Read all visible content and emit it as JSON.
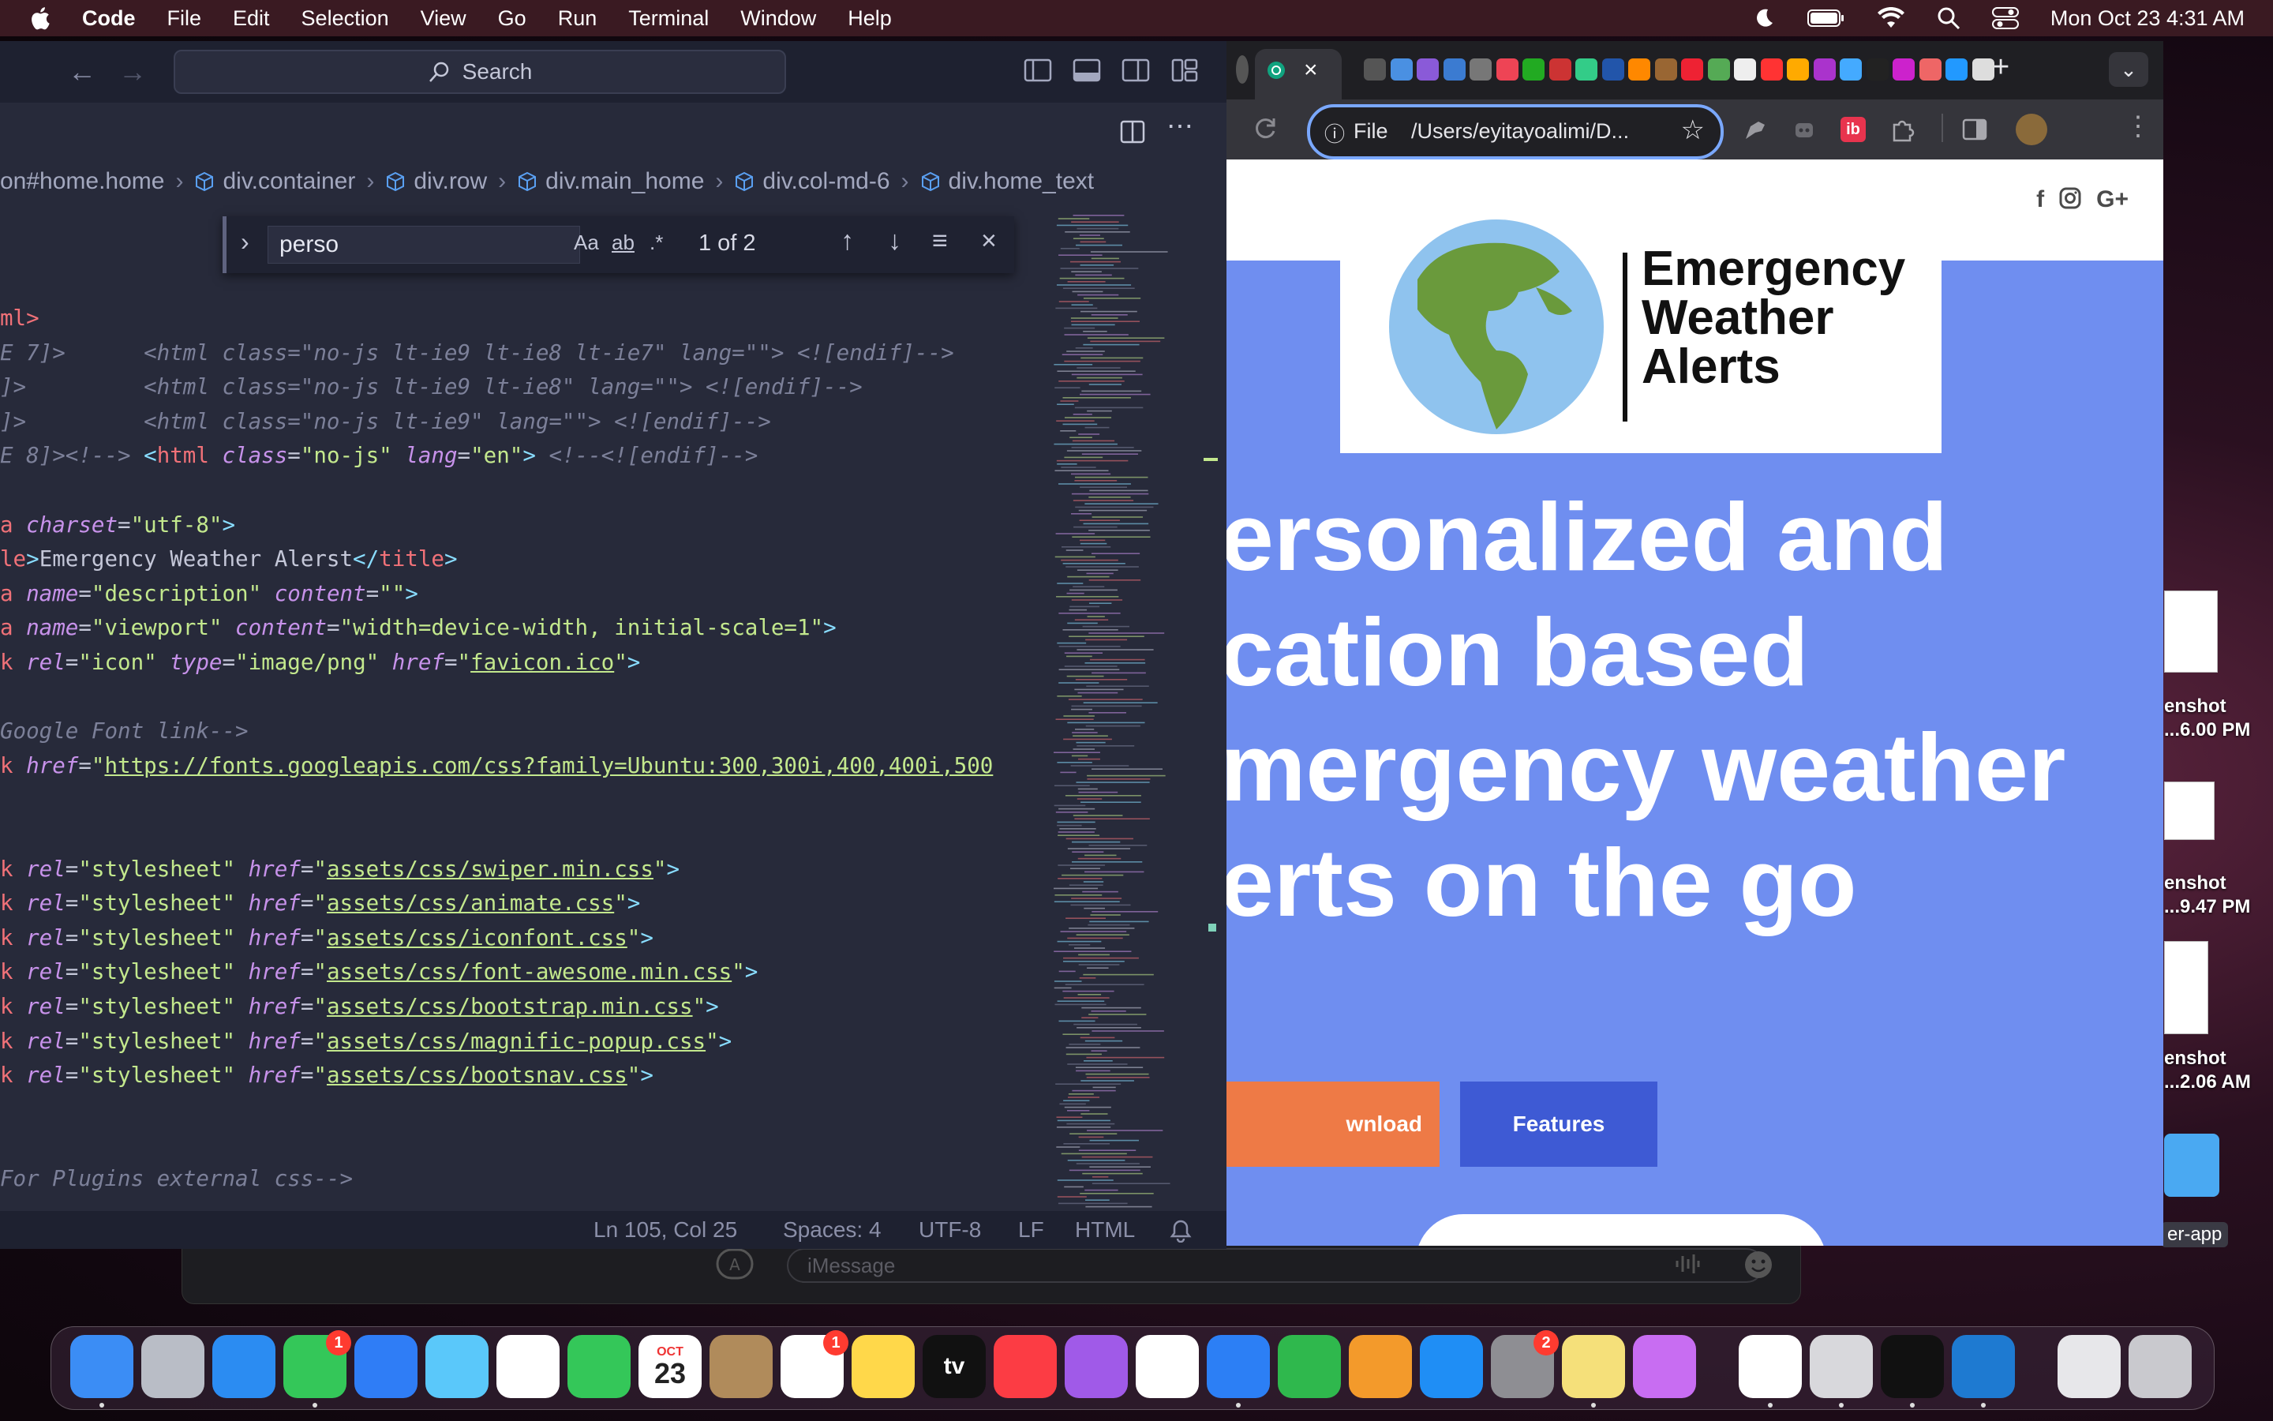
{
  "menubar": {
    "app_name": "Code",
    "items": [
      "File",
      "Edit",
      "Selection",
      "View",
      "Go",
      "Run",
      "Terminal",
      "Window",
      "Help"
    ],
    "clock": "Mon Oct 23  4:31 AM"
  },
  "vscode": {
    "search_label": "Search",
    "breadcrumb": [
      "on#home.home",
      "div.container",
      "div.row",
      "div.main_home",
      "div.col-md-6",
      "div.home_text"
    ],
    "find": {
      "query": "perso",
      "match_case": "Aa",
      "whole_word": "ab",
      "regex": ".*",
      "count": "1 of 2"
    },
    "code_lines": [
      {
        "segments": [
          {
            "t": "ml>",
            "c": "tg"
          }
        ]
      },
      {
        "segments": [
          {
            "t": "E 7]>      ",
            "c": "cm"
          },
          {
            "t": "<html class=\"no-js lt-ie9 lt-ie8 lt-ie7\" lang=\"\"> <![endif]-->",
            "c": "cm"
          }
        ]
      },
      {
        "segments": [
          {
            "t": "]>         ",
            "c": "cm"
          },
          {
            "t": "<html class=\"no-js lt-ie9 lt-ie8\" lang=\"\"> <![endif]-->",
            "c": "cm"
          }
        ]
      },
      {
        "segments": [
          {
            "t": "]>         ",
            "c": "cm"
          },
          {
            "t": "<html class=\"no-js lt-ie9\" lang=\"\"> <![endif]-->",
            "c": "cm"
          }
        ]
      },
      {
        "segments": [
          {
            "t": "E 8]><!--> ",
            "c": "cm"
          },
          {
            "t": "<",
            "c": "tgp"
          },
          {
            "t": "html",
            "c": "tg"
          },
          {
            "t": " class",
            "c": "at"
          },
          {
            "t": "=",
            "c": ""
          },
          {
            "t": "\"no-js\"",
            "c": "st"
          },
          {
            "t": " lang",
            "c": "at"
          },
          {
            "t": "=",
            "c": ""
          },
          {
            "t": "\"en\"",
            "c": "st"
          },
          {
            "t": ">",
            "c": "tgp"
          },
          {
            "t": " <!--<![endif]-->",
            "c": "cm"
          }
        ]
      },
      {
        "segments": []
      },
      {
        "segments": [
          {
            "t": "a",
            "c": "tg"
          },
          {
            "t": " charset",
            "c": "at"
          },
          {
            "t": "=",
            "c": ""
          },
          {
            "t": "\"utf-8\"",
            "c": "st"
          },
          {
            "t": ">",
            "c": "tgp"
          }
        ]
      },
      {
        "segments": [
          {
            "t": "le",
            "c": "tg"
          },
          {
            "t": ">",
            "c": "tgp"
          },
          {
            "t": "Emergency Weather Alerst",
            "c": ""
          },
          {
            "t": "</",
            "c": "tgp"
          },
          {
            "t": "title",
            "c": "tg"
          },
          {
            "t": ">",
            "c": "tgp"
          }
        ]
      },
      {
        "segments": [
          {
            "t": "a",
            "c": "tg"
          },
          {
            "t": " name",
            "c": "at"
          },
          {
            "t": "=",
            "c": ""
          },
          {
            "t": "\"description\"",
            "c": "st"
          },
          {
            "t": " content",
            "c": "at"
          },
          {
            "t": "=",
            "c": ""
          },
          {
            "t": "\"\"",
            "c": "st"
          },
          {
            "t": ">",
            "c": "tgp"
          }
        ]
      },
      {
        "segments": [
          {
            "t": "a",
            "c": "tg"
          },
          {
            "t": " name",
            "c": "at"
          },
          {
            "t": "=",
            "c": ""
          },
          {
            "t": "\"viewport\"",
            "c": "st"
          },
          {
            "t": " content",
            "c": "at"
          },
          {
            "t": "=",
            "c": ""
          },
          {
            "t": "\"width=device-width, initial-scale=1\"",
            "c": "st"
          },
          {
            "t": ">",
            "c": "tgp"
          }
        ]
      },
      {
        "segments": [
          {
            "t": "k",
            "c": "tg"
          },
          {
            "t": " rel",
            "c": "at"
          },
          {
            "t": "=",
            "c": ""
          },
          {
            "t": "\"icon\"",
            "c": "st"
          },
          {
            "t": " type",
            "c": "at"
          },
          {
            "t": "=",
            "c": ""
          },
          {
            "t": "\"image/png\"",
            "c": "st"
          },
          {
            "t": " href",
            "c": "at"
          },
          {
            "t": "=",
            "c": ""
          },
          {
            "t": "\"",
            "c": "st"
          },
          {
            "t": "favicon.ico",
            "c": "st ul"
          },
          {
            "t": "\"",
            "c": "st"
          },
          {
            "t": ">",
            "c": "tgp"
          }
        ]
      },
      {
        "segments": []
      },
      {
        "segments": [
          {
            "t": "Google Font link-->",
            "c": "cm"
          }
        ]
      },
      {
        "segments": [
          {
            "t": "k",
            "c": "tg"
          },
          {
            "t": " href",
            "c": "at"
          },
          {
            "t": "=",
            "c": ""
          },
          {
            "t": "\"",
            "c": "st"
          },
          {
            "t": "https://fonts.googleapis.com/css?family=Ubuntu:300,300i,400,400i,500",
            "c": "st ul"
          }
        ]
      },
      {
        "segments": []
      },
      {
        "segments": []
      },
      {
        "segments": [
          {
            "t": "k",
            "c": "tg"
          },
          {
            "t": " rel",
            "c": "at"
          },
          {
            "t": "=",
            "c": ""
          },
          {
            "t": "\"stylesheet\"",
            "c": "st"
          },
          {
            "t": " href",
            "c": "at"
          },
          {
            "t": "=",
            "c": ""
          },
          {
            "t": "\"",
            "c": "st"
          },
          {
            "t": "assets/css/swiper.min.css",
            "c": "st ul"
          },
          {
            "t": "\"",
            "c": "st"
          },
          {
            "t": ">",
            "c": "tgp"
          }
        ]
      },
      {
        "segments": [
          {
            "t": "k",
            "c": "tg"
          },
          {
            "t": " rel",
            "c": "at"
          },
          {
            "t": "=",
            "c": ""
          },
          {
            "t": "\"stylesheet\"",
            "c": "st"
          },
          {
            "t": " href",
            "c": "at"
          },
          {
            "t": "=",
            "c": ""
          },
          {
            "t": "\"",
            "c": "st"
          },
          {
            "t": "assets/css/animate.css",
            "c": "st ul"
          },
          {
            "t": "\"",
            "c": "st"
          },
          {
            "t": ">",
            "c": "tgp"
          }
        ]
      },
      {
        "segments": [
          {
            "t": "k",
            "c": "tg"
          },
          {
            "t": " rel",
            "c": "at"
          },
          {
            "t": "=",
            "c": ""
          },
          {
            "t": "\"stylesheet\"",
            "c": "st"
          },
          {
            "t": " href",
            "c": "at"
          },
          {
            "t": "=",
            "c": ""
          },
          {
            "t": "\"",
            "c": "st"
          },
          {
            "t": "assets/css/iconfont.css",
            "c": "st ul"
          },
          {
            "t": "\"",
            "c": "st"
          },
          {
            "t": ">",
            "c": "tgp"
          }
        ]
      },
      {
        "segments": [
          {
            "t": "k",
            "c": "tg"
          },
          {
            "t": " rel",
            "c": "at"
          },
          {
            "t": "=",
            "c": ""
          },
          {
            "t": "\"stylesheet\"",
            "c": "st"
          },
          {
            "t": " href",
            "c": "at"
          },
          {
            "t": "=",
            "c": ""
          },
          {
            "t": "\"",
            "c": "st"
          },
          {
            "t": "assets/css/font-awesome.min.css",
            "c": "st ul"
          },
          {
            "t": "\"",
            "c": "st"
          },
          {
            "t": ">",
            "c": "tgp"
          }
        ]
      },
      {
        "segments": [
          {
            "t": "k",
            "c": "tg"
          },
          {
            "t": " rel",
            "c": "at"
          },
          {
            "t": "=",
            "c": ""
          },
          {
            "t": "\"stylesheet\"",
            "c": "st"
          },
          {
            "t": " href",
            "c": "at"
          },
          {
            "t": "=",
            "c": ""
          },
          {
            "t": "\"",
            "c": "st"
          },
          {
            "t": "assets/css/bootstrap.min.css",
            "c": "st ul"
          },
          {
            "t": "\"",
            "c": "st"
          },
          {
            "t": ">",
            "c": "tgp"
          }
        ]
      },
      {
        "segments": [
          {
            "t": "k",
            "c": "tg"
          },
          {
            "t": " rel",
            "c": "at"
          },
          {
            "t": "=",
            "c": ""
          },
          {
            "t": "\"stylesheet\"",
            "c": "st"
          },
          {
            "t": " href",
            "c": "at"
          },
          {
            "t": "=",
            "c": ""
          },
          {
            "t": "\"",
            "c": "st"
          },
          {
            "t": "assets/css/magnific-popup.css",
            "c": "st ul"
          },
          {
            "t": "\"",
            "c": "st"
          },
          {
            "t": ">",
            "c": "tgp"
          }
        ]
      },
      {
        "segments": [
          {
            "t": "k",
            "c": "tg"
          },
          {
            "t": " rel",
            "c": "at"
          },
          {
            "t": "=",
            "c": ""
          },
          {
            "t": "\"stylesheet\"",
            "c": "st"
          },
          {
            "t": " href",
            "c": "at"
          },
          {
            "t": "=",
            "c": ""
          },
          {
            "t": "\"",
            "c": "st"
          },
          {
            "t": "assets/css/bootsnav.css",
            "c": "st ul"
          },
          {
            "t": "\"",
            "c": "st"
          },
          {
            "t": ">",
            "c": "tgp"
          }
        ]
      },
      {
        "segments": []
      },
      {
        "segments": []
      },
      {
        "segments": [
          {
            "t": "For Plugins external css-->",
            "c": "cm"
          }
        ]
      }
    ],
    "status": {
      "position": "Ln 105, Col 25",
      "spaces": "Spaces: 4",
      "encoding": "UTF-8",
      "eol": "LF",
      "language": "HTML"
    }
  },
  "chrome": {
    "omnibox": {
      "scheme_label": "File",
      "url": "/Users/eyitayoalimi/D..."
    },
    "page": {
      "brand_lines": [
        "Emergency",
        "Weather",
        "Alerts"
      ],
      "hero_lines": [
        "ersonalized and",
        "cation based",
        "mergency weather",
        "erts on the go"
      ],
      "download_label": "wnload",
      "features_label": "Features"
    },
    "social_icons": [
      "facebook-icon",
      "instagram-icon",
      "google-plus-icon"
    ]
  },
  "messages": {
    "placeholder": "iMessage"
  },
  "desktop": {
    "screenshots": [
      {
        "line1": "enshot",
        "line2": "...6.00 PM"
      },
      {
        "line1": "enshot",
        "line2": "...9.47 PM"
      },
      {
        "line1": "enshot",
        "line2": "...2.06 AM"
      }
    ],
    "folder_label": "er-app"
  },
  "dock": {
    "calendar_month": "OCT",
    "calendar_day": "23",
    "tv_label": "tv",
    "badges": {
      "messages": "1",
      "reminders": "1",
      "settings": "2"
    },
    "colors": {
      "finder": "#3b8df5",
      "launchpad": "#b9bdc6",
      "safari": "#2b8cf2",
      "messages": "#34c759",
      "mail": "#2f7df6",
      "maps": "#5ac8fa",
      "photos": "#ffffff",
      "facetime": "#34c759",
      "calendar": "#ffffff",
      "contacts": "#b08b5b",
      "reminders": "#ffffff",
      "notes": "#ffd84a",
      "tv": "#111111",
      "music": "#fc3c44",
      "podcasts": "#a05ae8",
      "news": "#ffffff",
      "keynote": "#2c7ff5",
      "numbers": "#2fb84d",
      "pages": "#f39a2b",
      "appstore": "#1f8ef5",
      "settings": "#8e8e93",
      "stickies": "#f5e07a",
      "siri": "#c86df2",
      "chrome": "#ffffff",
      "preview": "#d8d8dc",
      "terminal": "#111111",
      "vscode": "#1e7ad1",
      "downloads": "#e7e7ea",
      "trash": "#c9c9ce"
    }
  }
}
